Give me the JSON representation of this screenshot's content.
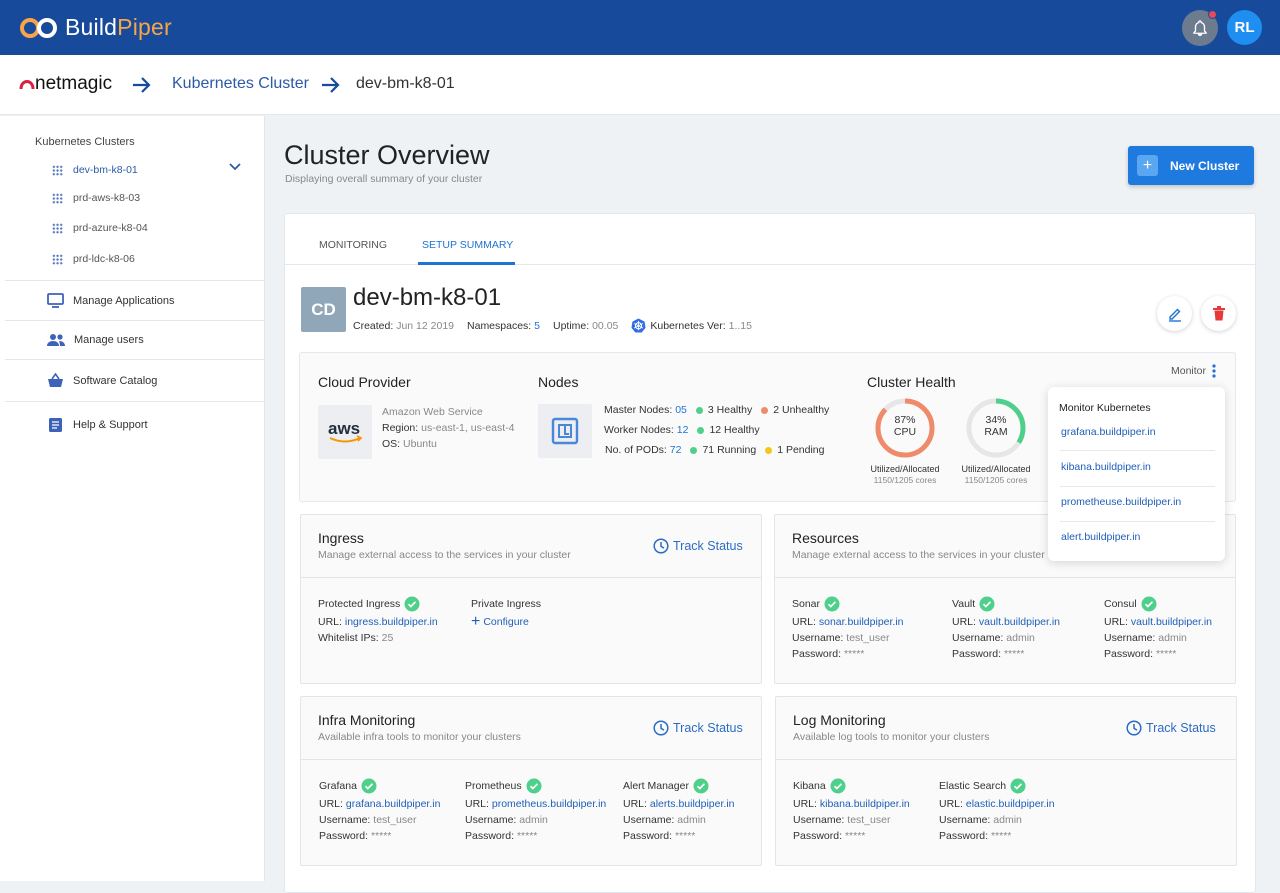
{
  "header": {
    "logo_build": "Build",
    "logo_piper": "Piper",
    "avatar": "RL"
  },
  "breadcrumb": {
    "brand": "netmagic",
    "link": "Kubernetes Cluster",
    "current": "dev-bm-k8-01"
  },
  "sidebar": {
    "heading": "Kubernetes Clusters",
    "clusters": [
      "dev-bm-k8-01",
      "prd-aws-k8-03",
      "prd-azure-k8-04",
      "prd-ldc-k8-06"
    ],
    "menu": [
      "Manage Applications",
      "Manage users",
      "Software Catalog",
      "Help & Support"
    ]
  },
  "page": {
    "title": "Cluster Overview",
    "subtitle": "Displaying overall summary of your cluster",
    "new_button": "New Cluster"
  },
  "tabs": [
    "MONITORING",
    "SETUP SUMMARY"
  ],
  "cluster": {
    "initials": "CD",
    "name": "dev-bm-k8-01",
    "created_label": "Created:",
    "created": "Jun 12 2019",
    "ns_label": "Namespaces:",
    "ns": "5",
    "uptime_label": "Uptime:",
    "uptime": "00.05",
    "k8s_label": "Kubernetes Ver:",
    "k8s": "1..15"
  },
  "provider": {
    "title": "Cloud Provider",
    "logo": "aws",
    "name": "Amazon Web Service",
    "region_label": "Region:",
    "region": "us-east-1, us-east-4",
    "os_label": "OS:",
    "os": "Ubuntu"
  },
  "nodes": {
    "title": "Nodes",
    "master_label": "Master Nodes:",
    "master": "05",
    "master_healthy": "3 Healthy",
    "master_unhealthy": "2 Unhealthy",
    "worker_label": "Worker Nodes:",
    "worker": "12",
    "worker_healthy": "12 Healthy",
    "pods_label": "No. of PODs:",
    "pods": "72",
    "pods_running": "71 Running",
    "pods_pending": "1 Pending"
  },
  "health": {
    "title": "Cluster Health",
    "monitor": "Monitor",
    "cpu": {
      "pct": "87%",
      "label": "CPU",
      "value": 0.87,
      "util": "Utilized/Allocated",
      "cores": "1150/1205 cores",
      "color": "#ef8a6a"
    },
    "ram": {
      "pct": "34%",
      "label": "RAM",
      "value": 0.34,
      "util": "Utilized/Allocated",
      "cores": "1150/1205 cores",
      "color": "#4fd08a"
    }
  },
  "popover": {
    "title": "Monitor Kubernetes",
    "links": [
      "grafana.buildpiper.in",
      "kibana.buildpiper.in",
      "prometheuse.buildpiper.in",
      "alert.buildpiper.in"
    ]
  },
  "ingress": {
    "title": "Ingress",
    "subtitle": "Manage external access to the services in your cluster",
    "track": "Track Status",
    "protected": "Protected Ingress",
    "url_label": "URL:",
    "url": "ingress.buildpiper.in",
    "whitelist_label": "Whitelist IPs:",
    "whitelist": "25",
    "private": "Private Ingress",
    "configure": "Configure"
  },
  "resources": {
    "title": "Resources",
    "subtitle": "Manage external access to the services in your cluster",
    "tools": [
      {
        "name": "Sonar",
        "url": "sonar.buildpiper.in",
        "username": "test_user",
        "password": "*****"
      },
      {
        "name": "Vault",
        "url": "vault.buildpiper.in",
        "username": "admin",
        "password": "*****"
      },
      {
        "name": "Consul",
        "url": "vault.buildpiper.in",
        "username": "admin",
        "password": "*****"
      }
    ]
  },
  "infra": {
    "title": "Infra Monitoring",
    "subtitle": "Available infra tools to monitor your clusters",
    "track": "Track Status",
    "tools": [
      {
        "name": "Grafana",
        "url": "grafana.buildpiper.in",
        "username": "test_user",
        "password": "*****"
      },
      {
        "name": "Prometheus",
        "url": "prometheus.buildpiper.in",
        "username": "admin",
        "password": "*****"
      },
      {
        "name": "Alert Manager",
        "url": "alerts.buildpiper.in",
        "username": "admin",
        "password": "*****"
      }
    ]
  },
  "logmon": {
    "title": "Log Monitoring",
    "subtitle": "Available log tools to monitor your clusters",
    "track": "Track Status",
    "tools": [
      {
        "name": "Kibana",
        "url": "kibana.buildpiper.in",
        "username": "test_user",
        "password": "*****"
      },
      {
        "name": "Elastic Search",
        "url": "elastic.buildpiper.in",
        "username": "admin",
        "password": "*****"
      }
    ]
  },
  "labels": {
    "url": "URL:",
    "username": "Username:",
    "password": "Password:"
  },
  "colors": {
    "header": "#174a9b",
    "accent": "#1f7ae0",
    "healthy": "#4fd08a",
    "unhealthy": "#ef8a6a",
    "pending": "#f5c518"
  }
}
